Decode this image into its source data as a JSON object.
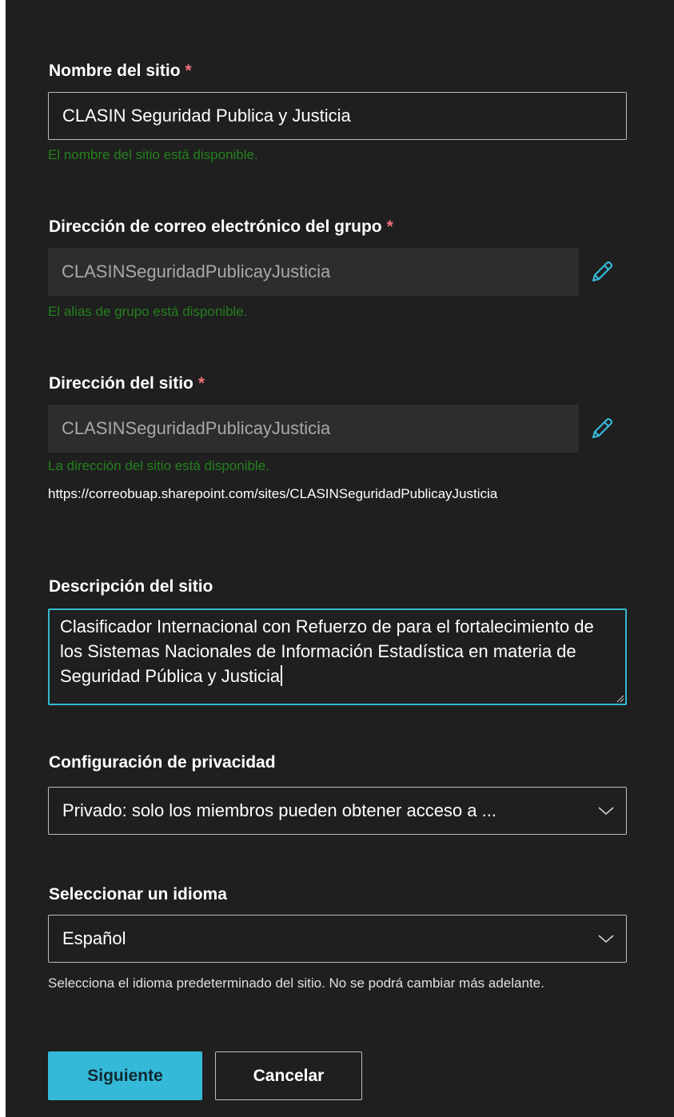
{
  "site_name": {
    "label": "Nombre del sitio",
    "required_mark": "*",
    "value": "CLASIN Seguridad Publica y Justicia",
    "status": "El nombre del sitio está disponible."
  },
  "group_email": {
    "label": "Dirección de correo electrónico del grupo",
    "required_mark": "*",
    "value": "CLASINSeguridadPublicayJusticia",
    "status": "El alias de grupo está disponible.",
    "edit_icon": "pencil-icon"
  },
  "site_address": {
    "label": "Dirección del sitio",
    "required_mark": "*",
    "value": "CLASINSeguridadPublicayJusticia",
    "status": "La dirección del sitio está disponible.",
    "url": "https://correobuap.sharepoint.com/sites/CLASINSeguridadPublicayJusticia",
    "edit_icon": "pencil-icon"
  },
  "site_description": {
    "label": "Descripción del sitio",
    "value": "Clasificador Internacional con Refuerzo de para el fortalecimiento de los Sistemas Nacionales de Información Estadística en materia de Seguridad Pública y Justicia"
  },
  "privacy": {
    "label": "Configuración de privacidad",
    "selected": "Privado: solo los miembros pueden obtener acceso a ..."
  },
  "language": {
    "label": "Seleccionar un idioma",
    "selected": "Español",
    "help": "Selecciona el idioma predeterminado del sitio. No se podrá cambiar más adelante."
  },
  "actions": {
    "next": "Siguiente",
    "cancel": "Cancelar"
  },
  "colors": {
    "background": "#1f1f1f",
    "success": "#24801d",
    "required": "#f1707b",
    "accent": "#35b9d8"
  }
}
